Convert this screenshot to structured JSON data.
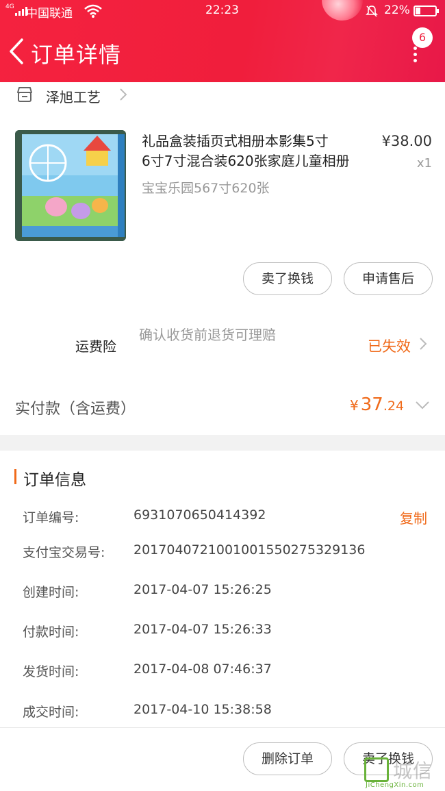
{
  "status_bar": {
    "network": "4G",
    "carrier": "中国联通",
    "time": "22:23",
    "battery": "22%"
  },
  "header": {
    "title": "订单详情",
    "badge_count": "6"
  },
  "shop": {
    "name": "泽旭工艺"
  },
  "product": {
    "title_line1": "礼品盒装插页式相册本影集5寸",
    "title_line2": "6寸7寸混合装620张家庭儿童相册",
    "variant": "宝宝乐园567寸620张",
    "price": "¥38.00",
    "quantity": "x1"
  },
  "actions": {
    "sell_label": "卖了换钱",
    "aftersale_label": "申请售后"
  },
  "insurance": {
    "label": "运费险",
    "desc": "确认收货前退货可理赔",
    "status": "已失效"
  },
  "payment": {
    "label": "实付款（含运费）",
    "currency": "¥",
    "amount_int": "37",
    "amount_dec": ".24"
  },
  "order_info": {
    "title": "订单信息",
    "copy_label": "复制",
    "rows": [
      {
        "key": "订单编号:",
        "value": "6931070650414392"
      },
      {
        "key": "支付宝交易号:",
        "value": "2017040721001001550275329136"
      },
      {
        "key": "创建时间:",
        "value": "2017-04-07 15:26:25"
      },
      {
        "key": "付款时间:",
        "value": "2017-04-07 15:26:33"
      },
      {
        "key": "发货时间:",
        "value": "2017-04-08 07:46:37"
      },
      {
        "key": "成交时间:",
        "value": "2017-04-10 15:38:58"
      }
    ]
  },
  "footer": {
    "delete_label": "删除订单",
    "sell_label": "卖了换钱"
  },
  "watermark": {
    "text": "城信",
    "sub": "JiChengXin.com"
  },
  "colors": {
    "header_red": "#f0223f",
    "accent_orange": "#f06a1a"
  }
}
